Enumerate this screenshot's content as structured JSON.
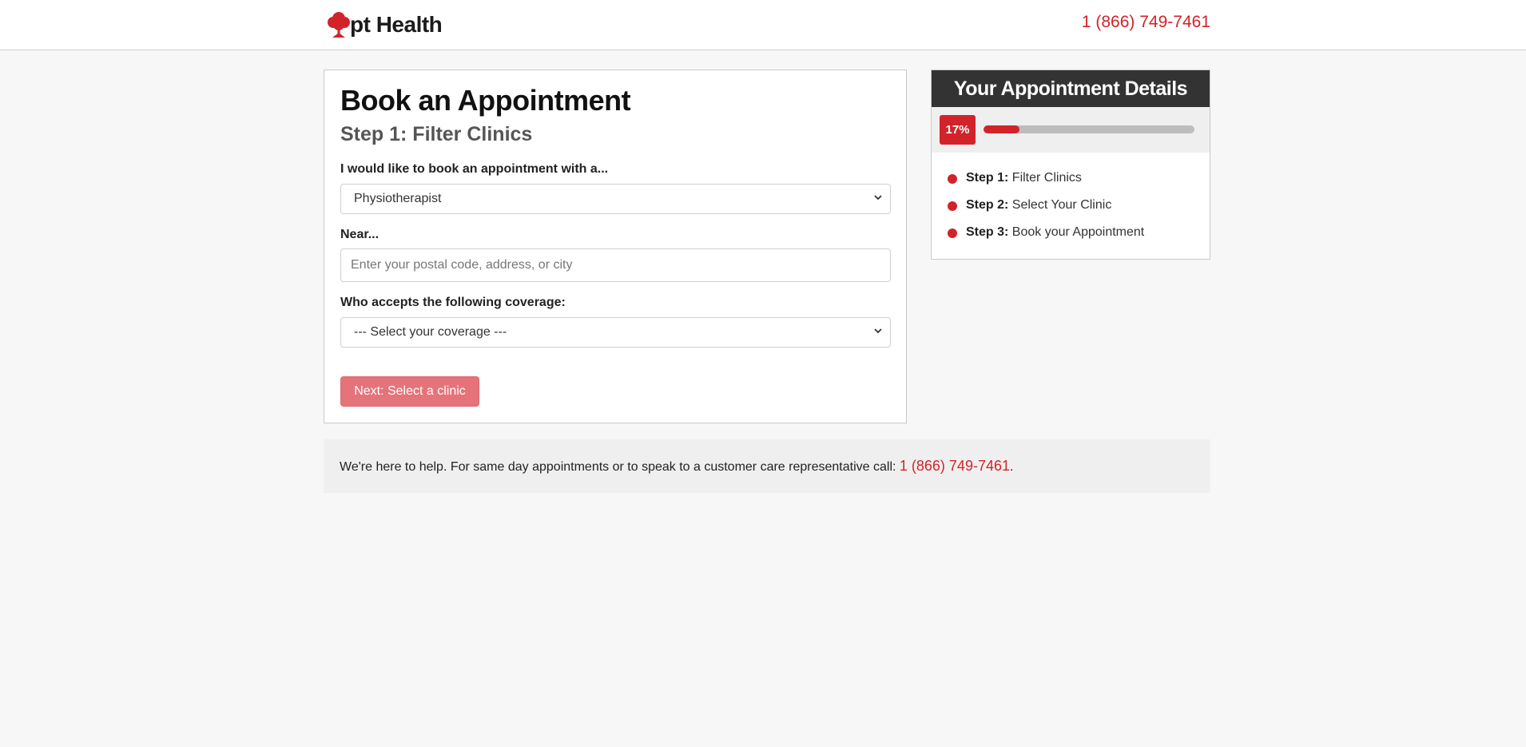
{
  "header": {
    "brand": "pt Health",
    "phone": "1 (866) 749-7461"
  },
  "form": {
    "title": "Book an Appointment",
    "step_title": "Step 1: Filter Clinics",
    "provider_label": "I would like to book an appointment with a...",
    "provider_value": "Physiotherapist",
    "near_label": "Near...",
    "near_placeholder": "Enter your postal code, address, or city",
    "coverage_label": "Who accepts the following coverage:",
    "coverage_value": "--- Select your coverage ---",
    "next_button": "Next: Select a clinic"
  },
  "details": {
    "title": "Your Appointment Details",
    "progress_label": "17%",
    "progress_percent": 17,
    "steps": [
      {
        "label": "Step 1:",
        "text": "Filter Clinics"
      },
      {
        "label": "Step 2:",
        "text": "Select Your Clinic"
      },
      {
        "label": "Step 3:",
        "text": "Book your Appointment"
      }
    ]
  },
  "help": {
    "text": "We're here to help. For same day appointments or to speak to a customer care representative call: ",
    "phone": "1 (866) 749-7461",
    "suffix": "."
  },
  "colors": {
    "brand_red": "#d2232a",
    "button_red": "#e5737a",
    "header_dark": "#333333"
  },
  "icons": {
    "logo": "tree-icon",
    "select_arrow": "chevron-down-icon",
    "step_bullet": "dot-icon"
  }
}
